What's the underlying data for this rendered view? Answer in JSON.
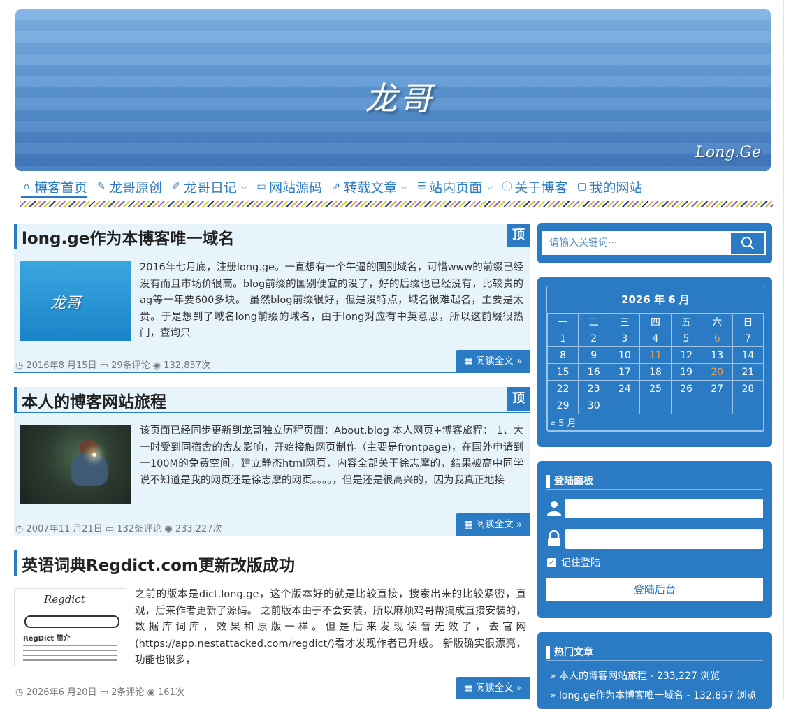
{
  "header": {
    "logo_text": "龙哥",
    "signature": "Long.Ge"
  },
  "nav": [
    {
      "label": "博客首页",
      "icon": "home-icon",
      "active": true
    },
    {
      "label": "龙哥原创",
      "icon": "pencil-icon"
    },
    {
      "label": "龙哥日记",
      "icon": "diary-icon",
      "dropdown": true
    },
    {
      "label": "网站源码",
      "icon": "code-icon"
    },
    {
      "label": "转载文章",
      "icon": "share-icon",
      "dropdown": true
    },
    {
      "label": "站内页面",
      "icon": "page-icon",
      "dropdown": true
    },
    {
      "label": "关于博客",
      "icon": "info-icon"
    },
    {
      "label": "我的网站",
      "icon": "monitor-icon"
    }
  ],
  "posts": [
    {
      "title": "long.ge作为本博客唯一域名",
      "pinned_label": "顶",
      "excerpt": "2016年七月底，注册long.ge。一直想有一个牛逼的国别域名，可惜www的前缀已经没有而且市场价很高。blog前缀的国别便宜的没了，好的后缀也已经没有，比较贵的ag等一年要600多块。 虽然blog前缀很好，但是没特点，域名很难起名，主要是太贵。于是想到了域名long前缀的域名，由于long对应有中英意思，所以这前缀很热门，查询只",
      "date": "2016年8 月15日",
      "comments": "29条评论",
      "views": "132,857次",
      "read_more": "阅读全文"
    },
    {
      "title": "本人的博客网站旅程",
      "pinned_label": "顶",
      "excerpt": "该页面已经同步更新到龙哥独立历程页面：About.blog 本人网页+博客旅程： 1、大一时受到同宿舍的舍友影响，开始接触网页制作（主要是frontpage)，在国外申请到一100M的免费空间，建立静态html网页，内容全部关于徐志摩的，结果被高中同学说不知道是我的网页还是徐志摩的网页。。。。，但是还是很高兴的，因为我真正地接",
      "date": "2007年11 月21日",
      "comments": "132条评论",
      "views": "233,227次",
      "read_more": "阅读全文"
    },
    {
      "title": "英语词典Regdict.com更新改版成功",
      "excerpt": "之前的版本是dict.long.ge，这个版本好的就是比较直接，搜索出来的比较紧密，直观，后来作者更新了源码。 之前版本由于不会安装，所以麻烦鸡哥帮搞成直接安装的，数据库词库，效果和原版一样。但是后来发现读音无效了，去官网(https://app.nestattacked.com/regdict/)看才发现作者已升级。 新版确实很漂亮，功能也很多，",
      "date": "2026年6 月20日",
      "comments": "2条评论",
      "views": "161次",
      "read_more": "阅读全文",
      "thumb": {
        "brand": "Regdict",
        "intro": "RegDict 简介"
      }
    }
  ],
  "sidebar": {
    "search_placeholder": "请输入关键词···",
    "calendar": {
      "title": "2026 年 6 月",
      "weekdays": [
        "一",
        "二",
        "三",
        "四",
        "五",
        "六",
        "日"
      ],
      "weeks": [
        [
          "1",
          "2",
          "3",
          "4",
          "5",
          "6",
          "7"
        ],
        [
          "8",
          "9",
          "10",
          "11",
          "12",
          "13",
          "14"
        ],
        [
          "15",
          "16",
          "17",
          "18",
          "19",
          "20",
          "21"
        ],
        [
          "22",
          "23",
          "24",
          "25",
          "26",
          "27",
          "28"
        ],
        [
          "29",
          "30",
          "",
          "",
          "",
          "",
          ""
        ]
      ],
      "highlighted": [
        "6",
        "11",
        "20"
      ],
      "prev_link": "« 5 月"
    },
    "login": {
      "title": "登陆面板",
      "remember": "记住登陆",
      "button": "登陆后台"
    },
    "hot": {
      "title": "热门文章",
      "items": [
        "» 本人的博客网站旅程 - 233,227 浏览",
        "» long.ge作为本博客唯一域名 - 132,857 浏览"
      ]
    }
  },
  "colors": {
    "accent": "#2a7bc4",
    "post_bg": "#e8f4fc",
    "highlight": "#f0a040"
  }
}
